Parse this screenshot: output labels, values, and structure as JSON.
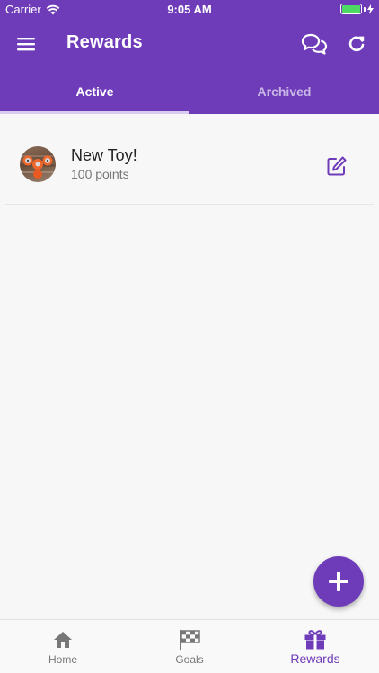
{
  "status_bar": {
    "carrier": "Carrier",
    "time": "9:05 AM"
  },
  "app_bar": {
    "title": "Rewards",
    "icons": [
      "menu-icon",
      "chat-icon",
      "refresh-icon"
    ]
  },
  "tabs": [
    {
      "label": "Active",
      "selected": true
    },
    {
      "label": "Archived",
      "selected": false
    }
  ],
  "rewards": [
    {
      "title": "New Toy!",
      "points": "100 points",
      "image": "fidget-spinner-photo"
    }
  ],
  "bottom_nav": [
    {
      "label": "Home",
      "icon": "home-icon",
      "selected": false
    },
    {
      "label": "Goals",
      "icon": "checkered-flag-icon",
      "selected": false
    },
    {
      "label": "Rewards",
      "icon": "gift-icon",
      "selected": true
    }
  ],
  "colors": {
    "primary": "#6f3cb9",
    "inactive_tab_text": "#c8b6e6",
    "nav_inactive": "#777777"
  }
}
